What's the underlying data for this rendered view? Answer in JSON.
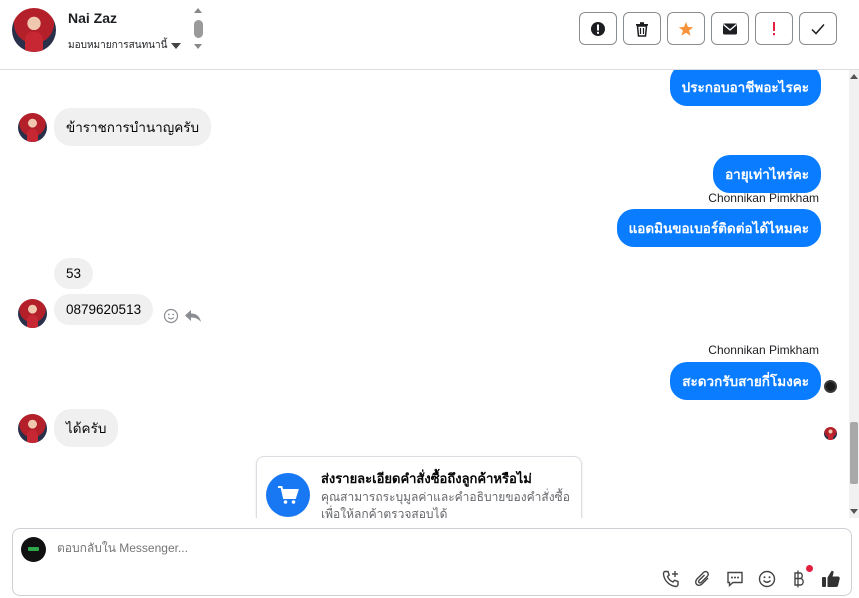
{
  "header": {
    "name": "Nai Zaz",
    "assign_label": "มอบหมายการสนทนานี้"
  },
  "actions": [
    {
      "name": "alert-icon",
      "color": "#1c1e21"
    },
    {
      "name": "trash-icon",
      "color": "#1c1e21"
    },
    {
      "name": "star-icon",
      "color": "#f7923a"
    },
    {
      "name": "envelope-icon",
      "color": "#1c1e21"
    },
    {
      "name": "exclamation-icon",
      "color": "#e41e3f"
    },
    {
      "name": "check-icon",
      "color": "#1c1e21"
    }
  ],
  "thread": {
    "msg_out_1": "ประกอบอาชีพอะไรคะ",
    "msg_in_1": "ข้าราชการบำนาญครับ",
    "msg_out_2": "อายุเท่าไหร่คะ",
    "sender_1": "Chonnikan Pimkham",
    "msg_out_3": "แอดมินขอเบอร์ติดต่อได้ไหมคะ",
    "msg_in_2": "53",
    "msg_in_3": "0879620513",
    "sender_2": "Chonnikan Pimkham",
    "msg_out_4": "สะดวกรับสายกี่โมงคะ",
    "msg_in_4": "ได้ครับ"
  },
  "card": {
    "title": "ส่งรายละเอียดคำสั่งซื้อถึงลูกค้าหรือไม่",
    "description": "คุณสามารถระบุมูลค่าและคำอธิบายของคำสั่งซื้อเพื่อให้ลูกค้าตรวจสอบได้"
  },
  "composer": {
    "placeholder": "ตอบกลับใน Messenger..."
  },
  "colors": {
    "accent": "#0a7cff",
    "bubble_in": "#f0f0f0"
  }
}
